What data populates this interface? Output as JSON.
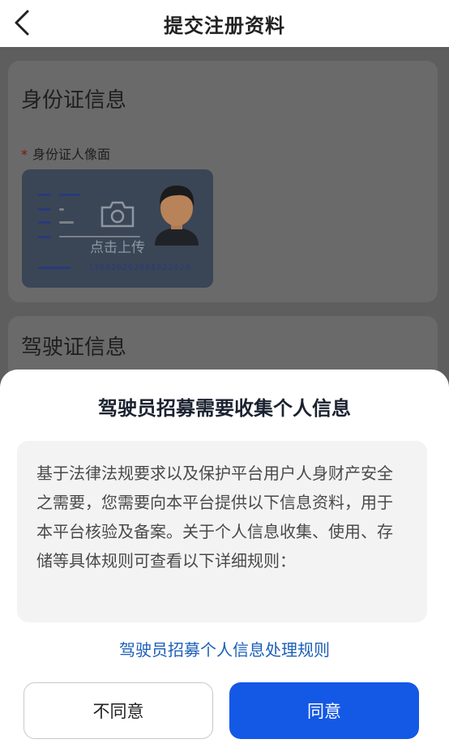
{
  "nav": {
    "title": "提交注册资料"
  },
  "section_id": {
    "title": "身份证信息",
    "required_marker": "*",
    "portrait_label": "身份证人像面",
    "upload_hint": "点击上传",
    "sample_id_number": "136826202008022829"
  },
  "section_license": {
    "title": "驾驶证信息"
  },
  "dialog": {
    "title": "驾驶员招募需要收集个人信息",
    "body": "基于法律法规要求以及保护平台用户人身财产安全之需要，您需要向本平台提供以下信息资料，用于本平台核验及备案。关于个人信息收集、使用、存储等具体规则可查看以下详细规则：",
    "rules_link": "驾驶员招募个人信息处理规则",
    "disagree_label": "不同意",
    "agree_label": "同意"
  },
  "colors": {
    "accent": "#1458e6",
    "link": "#1b5fb8",
    "required": "#8b0f0f"
  },
  "icons": {
    "back": "chevron-left-icon",
    "camera": "camera-icon",
    "avatar": "avatar-icon"
  }
}
